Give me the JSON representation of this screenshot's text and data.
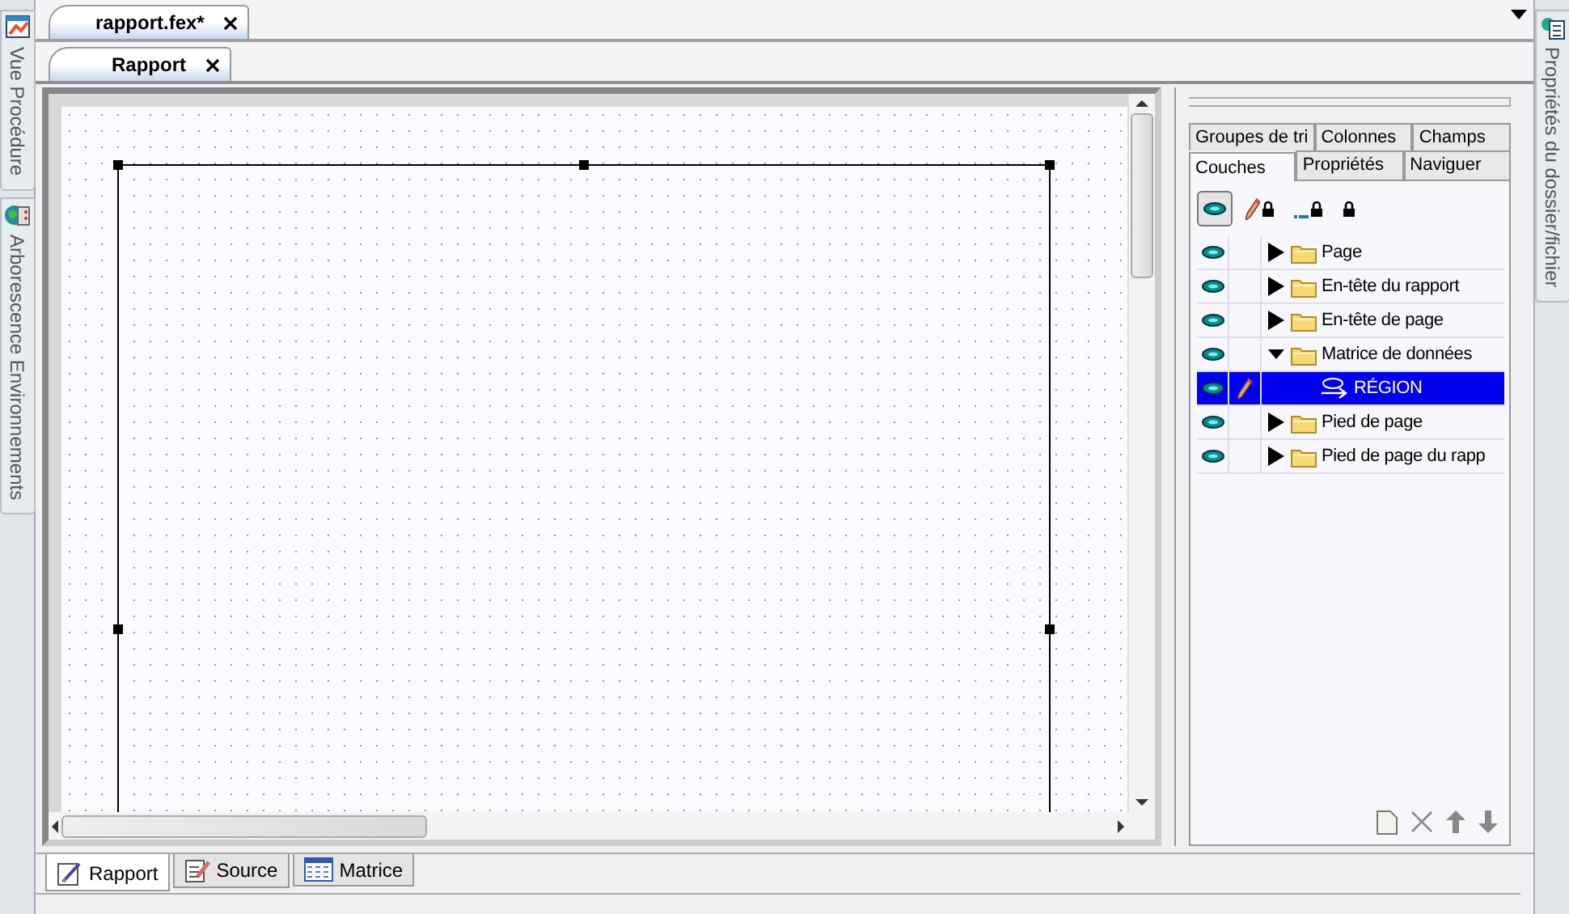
{
  "left_sidebar": {
    "tabs": [
      {
        "label": "Vue Procédure",
        "kind": "procedure"
      },
      {
        "label": "Arborescence Environnements",
        "kind": "environments"
      }
    ]
  },
  "document_tabs": [
    {
      "label": "rapport.fex*",
      "selected": true
    }
  ],
  "view_tabs": [
    {
      "label": "Rapport",
      "selected": true
    }
  ],
  "layers_panel": {
    "tab_rows": [
      [
        {
          "label": "Groupes de tri",
          "selected": false
        },
        {
          "label": "Colonnes",
          "selected": false
        },
        {
          "label": "Champs",
          "selected": false
        }
      ],
      [
        {
          "label": "Couches",
          "selected": true
        },
        {
          "label": "Propriétés",
          "selected": false
        },
        {
          "label": "Naviguer",
          "selected": false
        }
      ]
    ],
    "tools": [
      {
        "kind": "eye",
        "selected": true
      },
      {
        "kind": "pencil-lock",
        "selected": false
      },
      {
        "kind": "line-lock",
        "selected": false
      },
      {
        "kind": "lock",
        "selected": false
      }
    ],
    "layers": [
      {
        "label": "Page",
        "kind": "folder",
        "visible": true,
        "editable": false,
        "expanded": false,
        "selected": false
      },
      {
        "label": "En-tête du rapport",
        "kind": "folder",
        "visible": true,
        "editable": false,
        "expanded": false,
        "selected": false
      },
      {
        "label": "En-tête de page",
        "kind": "folder",
        "visible": true,
        "editable": false,
        "expanded": false,
        "selected": false
      },
      {
        "label": "Matrice de données",
        "kind": "folder",
        "visible": true,
        "editable": false,
        "expanded": true,
        "selected": false,
        "children": [
          {
            "label": "RÉGION",
            "kind": "region",
            "visible": true,
            "editable": true,
            "selected": true
          }
        ]
      },
      {
        "label": "Pied de page",
        "kind": "folder",
        "visible": true,
        "editable": false,
        "expanded": false,
        "selected": false
      },
      {
        "label": "Pied de page du rapp",
        "kind": "folder",
        "visible": true,
        "editable": false,
        "expanded": false,
        "selected": false
      }
    ]
  },
  "bottom_tabs": [
    {
      "label": "Rapport",
      "kind": "report",
      "selected": true
    },
    {
      "label": "Source",
      "kind": "source",
      "selected": false
    },
    {
      "label": "Matrice",
      "kind": "matrix",
      "selected": false
    }
  ],
  "right_sidebar": {
    "tabs": [
      {
        "label": "Propriétés du dossier/fichier",
        "kind": "properties"
      }
    ]
  }
}
